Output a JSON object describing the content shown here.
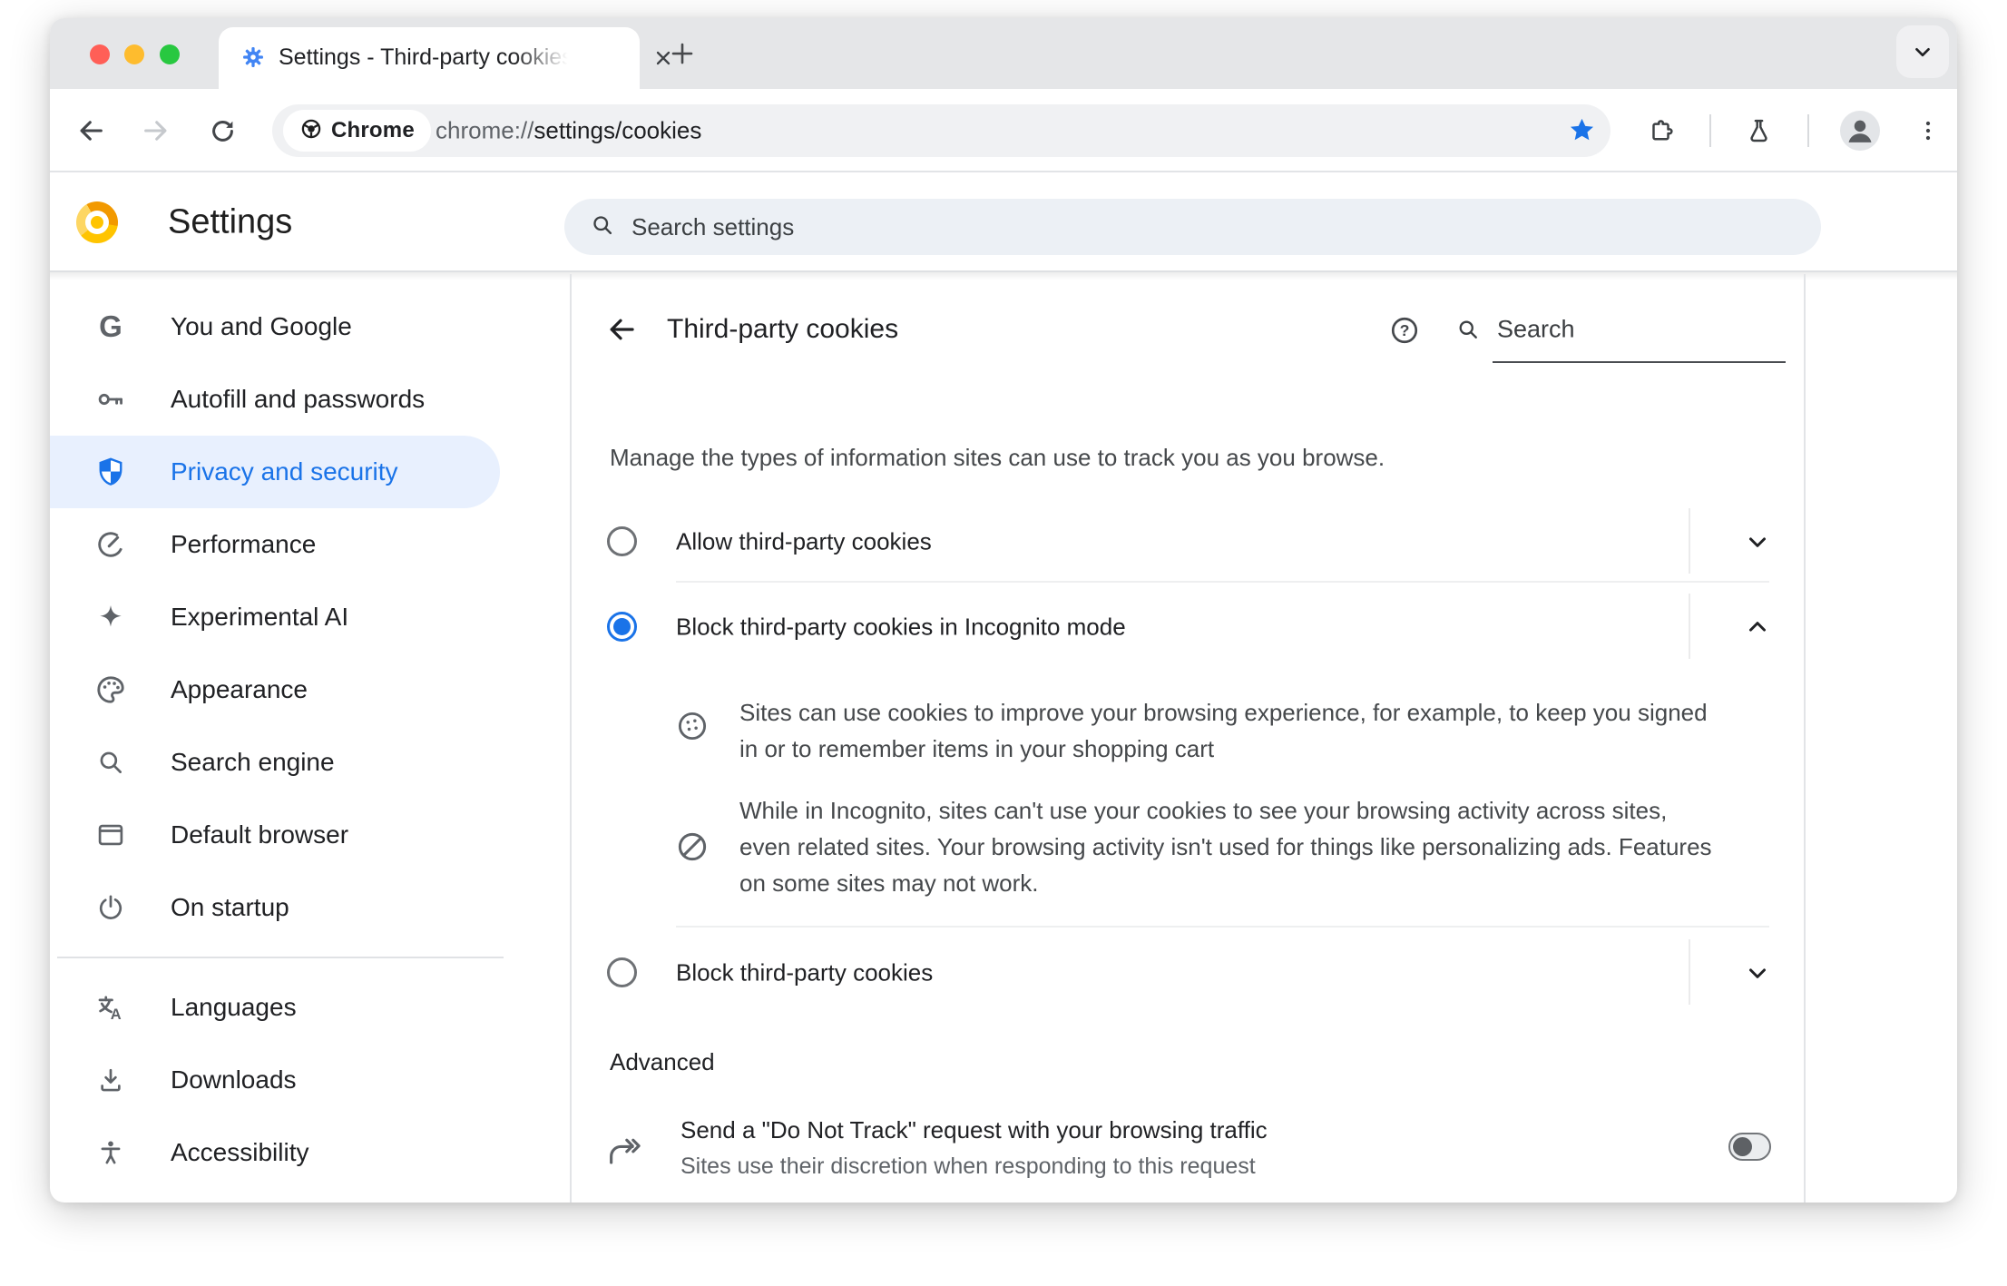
{
  "browser": {
    "tab_title": "Settings - Third-party cookies",
    "chip_label": "Chrome",
    "url_scheme": "chrome://",
    "url_path": "settings/cookies"
  },
  "settings_header": {
    "title": "Settings",
    "search_placeholder": "Search settings"
  },
  "sidebar": {
    "primary": [
      "You and Google",
      "Autofill and passwords",
      "Privacy and security",
      "Performance",
      "Experimental AI",
      "Appearance",
      "Search engine",
      "Default browser",
      "On startup"
    ],
    "secondary": [
      "Languages",
      "Downloads",
      "Accessibility"
    ],
    "selected": "Privacy and security"
  },
  "page": {
    "title": "Third-party cookies",
    "search_placeholder": "Search",
    "intro": "Manage the types of information sites can use to track you as you browse.",
    "options": [
      {
        "label": "Allow third-party cookies",
        "selected": false,
        "expanded": false
      },
      {
        "label": "Block third-party cookies in Incognito mode",
        "selected": true,
        "expanded": true
      },
      {
        "label": "Block third-party cookies",
        "selected": false,
        "expanded": false
      }
    ],
    "detail_cookie": "Sites can use cookies to improve your browsing experience, for example, to keep you signed\nin or to remember items in your shopping cart",
    "detail_incognito": "While in Incognito, sites can't use your cookies to see your browsing activity across sites,\neven related sites. Your browsing activity isn't used for things like personalizing ads. Features\non some sites may not work.",
    "advanced": "Advanced",
    "dnt_title": "Send a \"Do Not Track\" request with your browsing traffic",
    "dnt_sub": "Sites use their discretion when responding to this request",
    "dnt_enabled": false
  },
  "colors": {
    "accent": "#1A73E8",
    "selected_nav_bg": "#E8F0FE",
    "traffic_red": "#FF5F57",
    "traffic_yellow": "#FEBC2E",
    "traffic_green": "#28C840"
  }
}
